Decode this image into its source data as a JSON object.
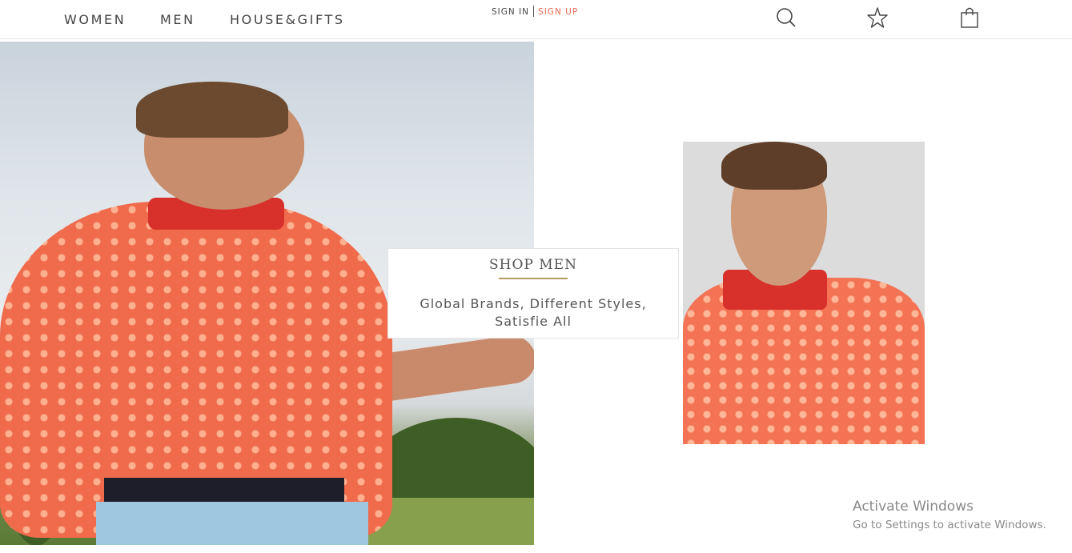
{
  "nav": {
    "women": "WOMEN",
    "men": "MEN",
    "house_gifts": "HOUSE&GIFTS"
  },
  "auth": {
    "sign_in": "SIGN IN",
    "sign_up": "SIGN UP"
  },
  "header_icons": [
    "search-icon",
    "star-icon",
    "shopping-bag-icon"
  ],
  "promo": {
    "title": "SHOP MEN",
    "subtitle": "Global Brands, Different Styles, Satisfie All"
  },
  "watermark": {
    "title": "Activate Windows",
    "subtitle": "Go to Settings to activate Windows."
  },
  "colors": {
    "accent_signup": "#e86a52",
    "underline": "#b79a60",
    "shirt": "#f06a4c"
  }
}
